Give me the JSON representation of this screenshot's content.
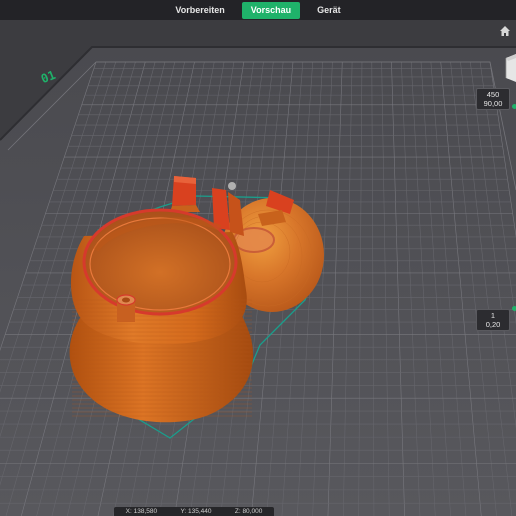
{
  "tabs": [
    {
      "label": "Vorbereiten",
      "active": false
    },
    {
      "label": "Vorschau",
      "active": true
    },
    {
      "label": "Gerät",
      "active": false
    }
  ],
  "bed_label": "01",
  "layer_slider": {
    "top": {
      "layer": "450",
      "height": "90,00"
    },
    "bottom": {
      "layer": "1",
      "height": "0,20"
    }
  },
  "status_bar": {
    "x": "X: 138,580",
    "y": "Y: 135,440",
    "z": "Z: 80,000"
  },
  "colors": {
    "accent": "#1fb26a",
    "model_orange": "#d86b1f",
    "wall_red": "#d63a2c",
    "skirt_teal": "#1a9e8c",
    "bed": "#4d4d52"
  },
  "icons": [
    "home-icon",
    "view-cube-icon"
  ]
}
